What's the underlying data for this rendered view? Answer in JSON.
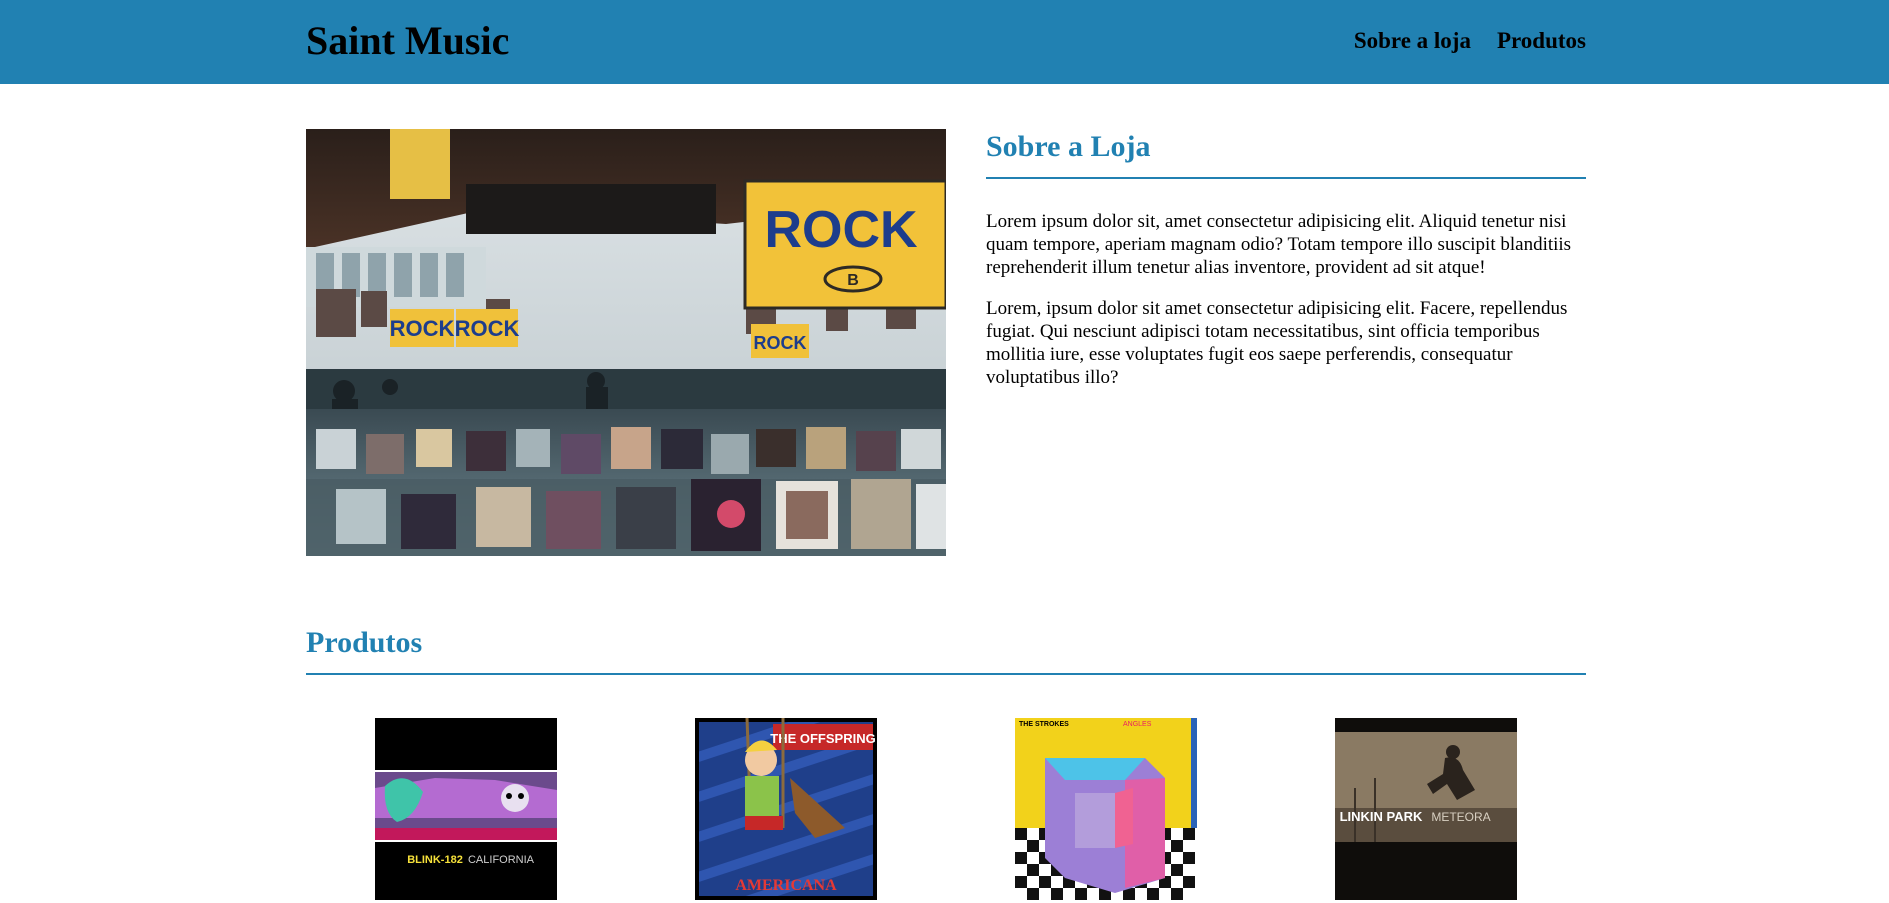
{
  "header": {
    "logo": "Saint Music",
    "nav": [
      {
        "label": "Sobre a loja"
      },
      {
        "label": "Produtos"
      }
    ]
  },
  "about": {
    "title": "Sobre a Loja",
    "paragraphs": [
      "Lorem ipsum dolor sit, amet consectetur adipisicing elit. Aliquid tenetur nisi quam tempore, aperiam magnam odio? Totam tempore illo suscipit blanditiis reprehenderit illum tenetur alias inventore, provident ad sit atque!",
      "Lorem, ipsum dolor sit amet consectetur adipisicing elit. Facere, repellendus fugiat. Qui nesciunt adipisci totam necessitatibus, sint officia temporibus mollitia iure, esse voluptates fugit eos saepe perferendis, consequatur voluptatibus illo?"
    ],
    "photo_signs": {
      "big": "ROCK",
      "big_sub": "B",
      "left_a": "ROCK",
      "left_b": "ROCK",
      "small": "ROCK"
    }
  },
  "products": {
    "title": "Produtos",
    "items": [
      {
        "cover_text": "BLINK-182",
        "cover_subtext": "CALIFORNIA"
      },
      {
        "cover_text": "THE OFFSPRING",
        "cover_subtext": "AMERICANA"
      },
      {
        "cover_text": "THE STROKES",
        "cover_subtext": "ANGLES"
      },
      {
        "cover_text": "LINKIN PARK",
        "cover_subtext": "METEORA"
      }
    ]
  },
  "colors": {
    "accent": "#2181b2",
    "background": "#ffffff",
    "text": "#000000"
  }
}
